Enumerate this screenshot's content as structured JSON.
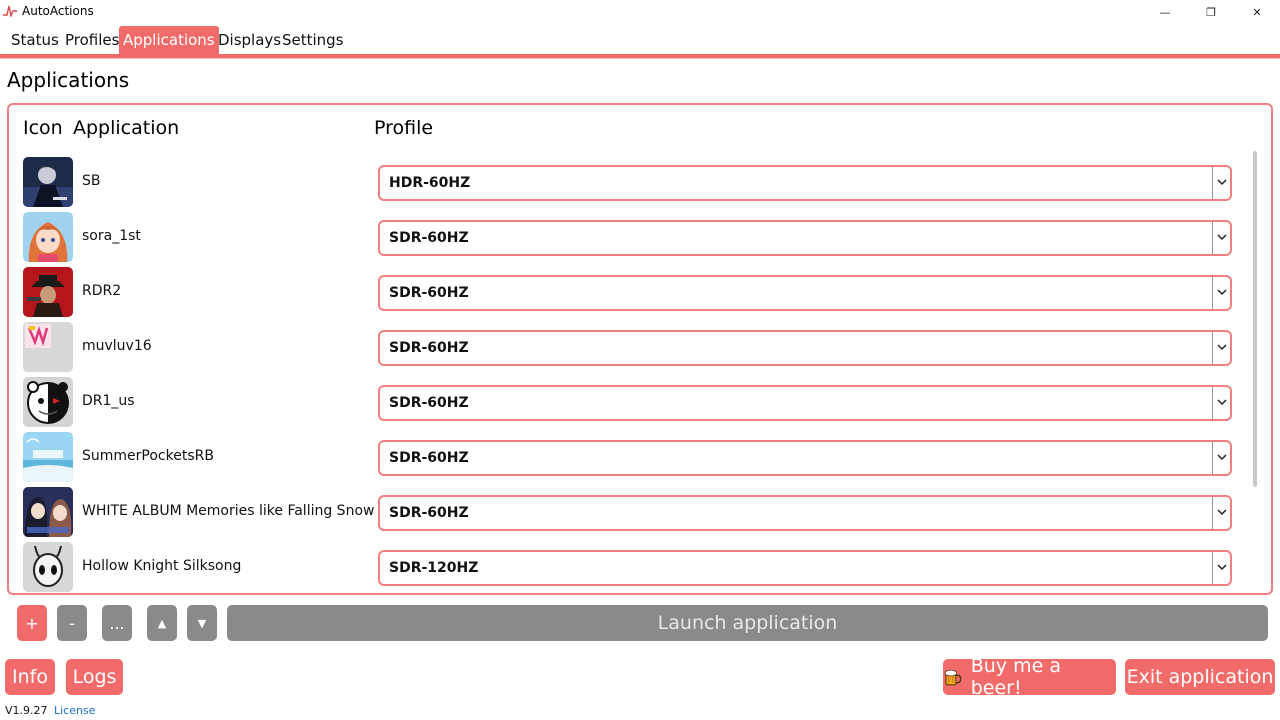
{
  "window": {
    "title": "AutoActions",
    "minimize": "—",
    "maximize": "❐",
    "close": "✕"
  },
  "tabs": [
    {
      "label": "Status",
      "active": false
    },
    {
      "label": "Profiles",
      "active": false
    },
    {
      "label": "Applications",
      "active": true
    },
    {
      "label": "Displays",
      "active": false
    },
    {
      "label": "Settings",
      "active": false
    }
  ],
  "page": {
    "title": "Applications",
    "columns": {
      "icon": "Icon",
      "application": "Application",
      "profile": "Profile"
    }
  },
  "applications": [
    {
      "name": "SB",
      "profile": "HDR-60HZ",
      "icon": "sb-game-icon"
    },
    {
      "name": "sora_1st",
      "profile": "SDR-60HZ",
      "icon": "sora-game-icon"
    },
    {
      "name": "RDR2",
      "profile": "SDR-60HZ",
      "icon": "rdr2-game-icon"
    },
    {
      "name": "muvluv16",
      "profile": "SDR-60HZ",
      "icon": "muvluv-game-icon"
    },
    {
      "name": "DR1_us",
      "profile": "SDR-60HZ",
      "icon": "dr1-game-icon"
    },
    {
      "name": "SummerPocketsRB",
      "profile": "SDR-60HZ",
      "icon": "summer-pockets-game-icon"
    },
    {
      "name": "WHITE ALBUM Memories like Falling Snow",
      "profile": "SDR-60HZ",
      "icon": "white-album-game-icon"
    },
    {
      "name": "Hollow Knight Silksong",
      "profile": "SDR-120HZ",
      "icon": "silksong-game-icon"
    }
  ],
  "actions": {
    "add": "+",
    "remove": "-",
    "more": "...",
    "move_up": "▲",
    "move_down": "▼",
    "launch": "Launch application"
  },
  "footer": {
    "info": "Info",
    "logs": "Logs",
    "beer": "Buy me a beer!",
    "exit": "Exit application",
    "version": "V1.9.27",
    "license": "License"
  },
  "colors": {
    "accent": "#f26b6b",
    "disabled": "#8a8a8a",
    "link": "#1a6fd0"
  }
}
